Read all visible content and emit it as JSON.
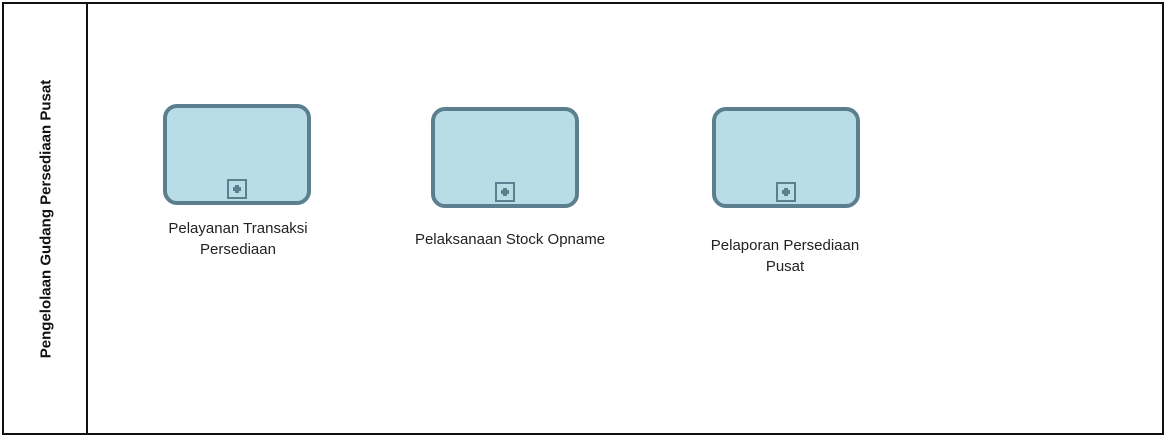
{
  "lane": {
    "title": "Pengelolaan Gudang Persediaan Pusat"
  },
  "tasks": [
    {
      "label": "Pelayanan Transaksi Persediaan"
    },
    {
      "label": "Pelaksanaan Stock Opname"
    },
    {
      "label": "Pelaporan Persediaan Pusat"
    }
  ],
  "colors": {
    "task_fill": "#b8dde7",
    "task_border": "#5b7f8e",
    "line": "#111111",
    "text": "#222222"
  },
  "icons": {
    "subprocess_marker": "plus-square-icon"
  }
}
